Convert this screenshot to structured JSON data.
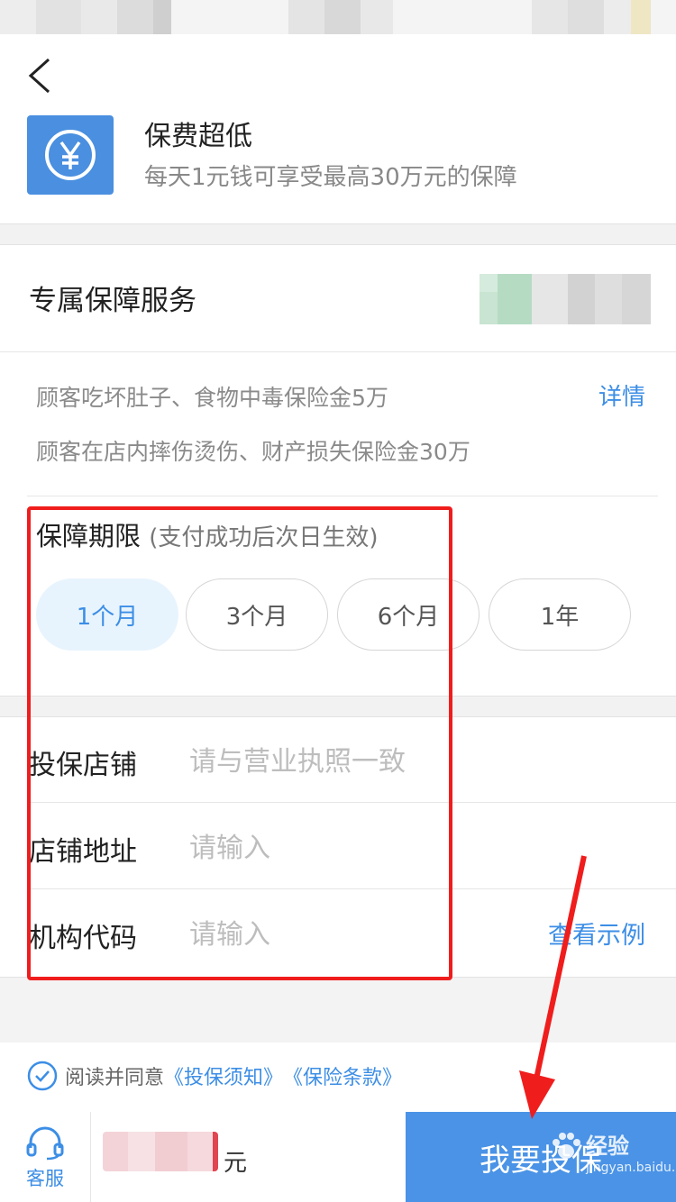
{
  "nav": {
    "back_icon": "chevron-left-icon"
  },
  "feature": {
    "icon": "yen-circle-icon",
    "title": "保费超低",
    "subtitle": "每天1元钱可享受最高30万元的保障"
  },
  "service": {
    "title": "专属保障服务",
    "coverage": [
      "顾客吃坏肚子、食物中毒保险金5万",
      "顾客在店内摔伤烫伤、财产损失保险金30万"
    ],
    "details_label": "详情"
  },
  "period": {
    "label": "保障期限",
    "note": "(支付成功后次日生效)",
    "options": [
      "1个月",
      "3个月",
      "6个月",
      "1年"
    ],
    "selected": "1个月"
  },
  "form": {
    "fields": [
      {
        "label": "投保店铺",
        "placeholder": "请与营业执照一致"
      },
      {
        "label": "店铺地址",
        "placeholder": "请输入"
      },
      {
        "label": "机构代码",
        "placeholder": "请输入"
      }
    ],
    "example_link": "查看示例"
  },
  "agreement": {
    "prefix": "阅读并同意",
    "link1": "《投保须知》",
    "link2": "《保险条款》",
    "checked": true
  },
  "footer": {
    "service_label": "客服",
    "service_icon": "headset-icon",
    "currency": "元",
    "buy_label": "我要投保"
  },
  "watermark": {
    "text": "经验",
    "sub": "jingyan.baidu.com"
  },
  "colors": {
    "accent": "#3c8ee6",
    "button": "#4a93e6",
    "annotation": "#f01d1d"
  }
}
